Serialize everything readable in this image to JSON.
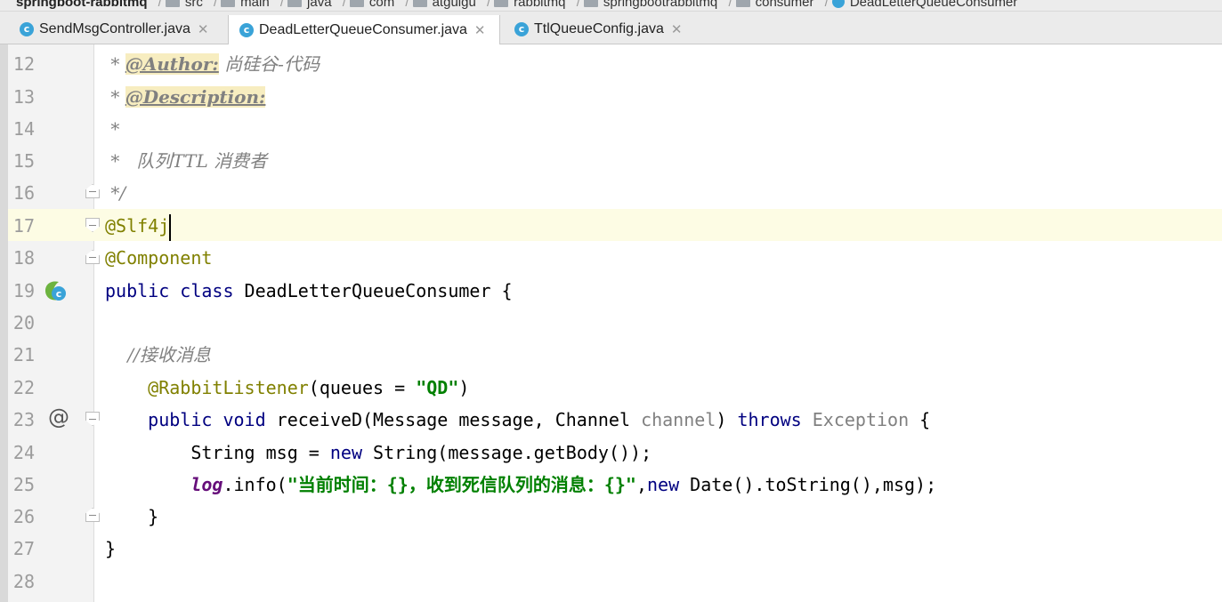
{
  "breadcrumb": {
    "project": "springboot-rabbitmq",
    "items": [
      "src",
      "main",
      "java",
      "com",
      "atguigu",
      "rabbitmq",
      "springbootrabbitmq",
      "consumer",
      "DeadLetterQueueConsumer"
    ]
  },
  "tabs": [
    {
      "label": "SendMsgController.java",
      "active": false
    },
    {
      "label": "DeadLetterQueueConsumer.java",
      "active": true
    },
    {
      "label": "TtlQueueConfig.java",
      "active": false
    }
  ],
  "line_numbers": [
    "12",
    "13",
    "14",
    "15",
    "16",
    "17",
    "18",
    "19",
    "20",
    "21",
    "22",
    "23",
    "24",
    "25",
    "26",
    "27",
    "28"
  ],
  "code": {
    "l12_star": " * ",
    "l12_tag": "@Author:",
    "l12_text": " 尚硅谷-代码",
    "l13_star": " * ",
    "l13_tag": "@Description:",
    "l14": " *",
    "l15": " *   队列TTL 消费者",
    "l16": " */",
    "l17_ann": "@Slf4j",
    "l18_ann": "@Component",
    "l19_kw": "public class ",
    "l19_name": "DeadLetterQueueConsumer {",
    "l21_comment": "    //接收消息",
    "l22_ann": "    @RabbitListener",
    "l22_pre": "(queues = ",
    "l22_str": "\"QD\"",
    "l22_post": ")",
    "l23_kw": "    public void ",
    "l23_mid": "receiveD(Message message, Channel ",
    "l23_param": "channel",
    "l23_close": ") ",
    "l23_throws": "throws ",
    "l23_exc": "Exception",
    "l23_end": " {",
    "l24_pre": "        String msg = ",
    "l24_new": "new ",
    "l24_post": "String(message.getBody());",
    "l25_indent": "        ",
    "l25_log": "log",
    "l25_mid": ".info(",
    "l25_str": "\"当前时间：{}，收到死信队列的消息：{}\"",
    "l25_comma": ",",
    "l25_new": "new ",
    "l25_post": "Date().toString(),msg);",
    "l26": "    }",
    "l27": "}"
  },
  "colors": {
    "keyword": "#000080",
    "annotation": "#808000",
    "comment": "#808080",
    "string": "#008000",
    "field": "#660e7a",
    "caret_line": "#fdfce4"
  },
  "icons": {
    "line19": "spring-bean-icon",
    "line23": "at-icon"
  }
}
